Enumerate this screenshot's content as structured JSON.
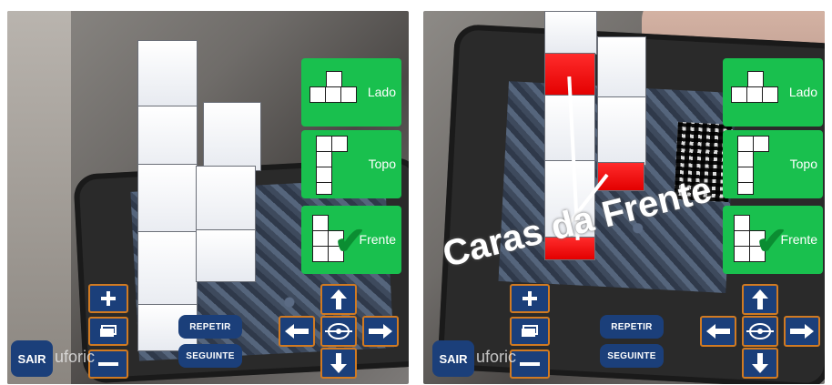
{
  "panels": [
    {
      "id": "left",
      "view_cards": [
        {
          "label": "Lado"
        },
        {
          "label": "Topo"
        },
        {
          "label": "Frente"
        }
      ],
      "buttons": {
        "repetir": "REPETIR",
        "seguinte": "SEGUINTE",
        "sair": "SAIR"
      },
      "brand": "uforic"
    },
    {
      "id": "right",
      "view_cards": [
        {
          "label": "Lado"
        },
        {
          "label": "Topo"
        },
        {
          "label": "Frente"
        }
      ],
      "buttons": {
        "repetir": "REPETIR",
        "seguinte": "SEGUINTE",
        "sair": "SAIR"
      },
      "brand": "uforic",
      "overlay_text": "Caras da Frente"
    }
  ],
  "colors": {
    "card_green": "#19c04e",
    "button_blue": "#1b3f7a",
    "button_border": "#d07a22",
    "highlight_red": "#e30000"
  },
  "icons": [
    "plus-icon",
    "minus-icon",
    "layers-icon",
    "arrow-up-icon",
    "arrow-down-icon",
    "arrow-left-icon",
    "arrow-right-icon",
    "target-icon",
    "check-icon"
  ]
}
